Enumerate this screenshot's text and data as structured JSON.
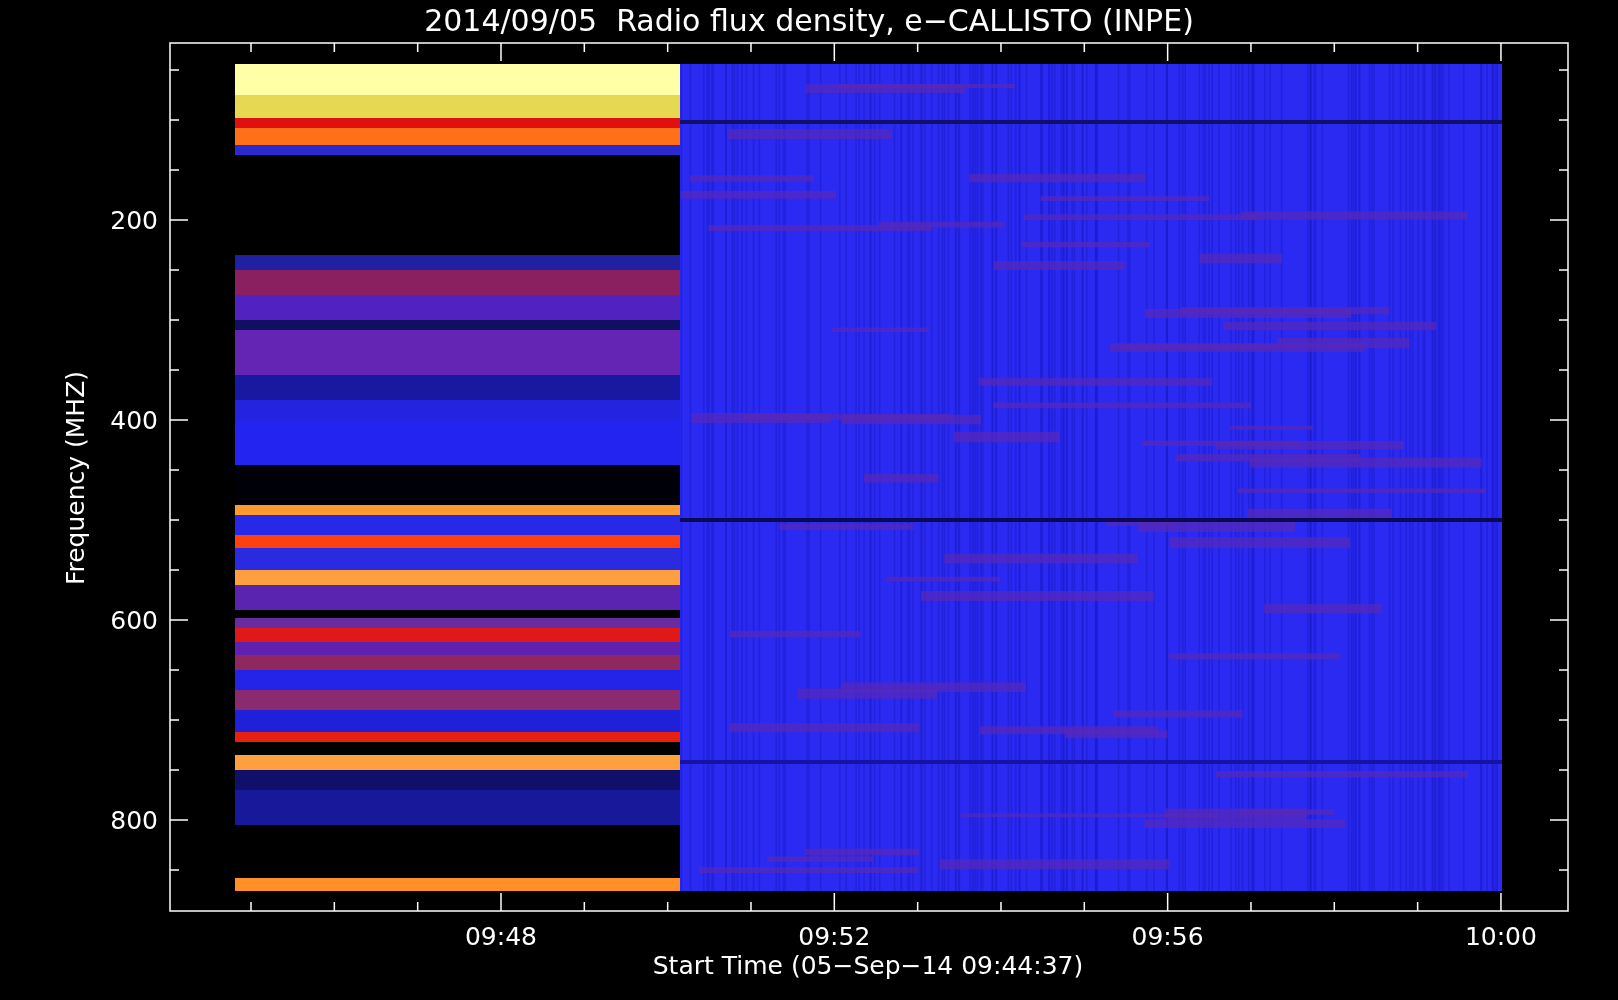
{
  "title": "2014/09/05  Radio flux density, e−CALLISTO (INPE)",
  "y_axis": {
    "label": "Frequency (MHZ)",
    "ticks": [
      "200",
      "400",
      "600",
      "800"
    ]
  },
  "x_axis": {
    "label": "Start Time (05−Sep−14 09:44:37)",
    "ticks": [
      "09:48",
      "09:52",
      "09:56",
      "10:00"
    ]
  }
}
